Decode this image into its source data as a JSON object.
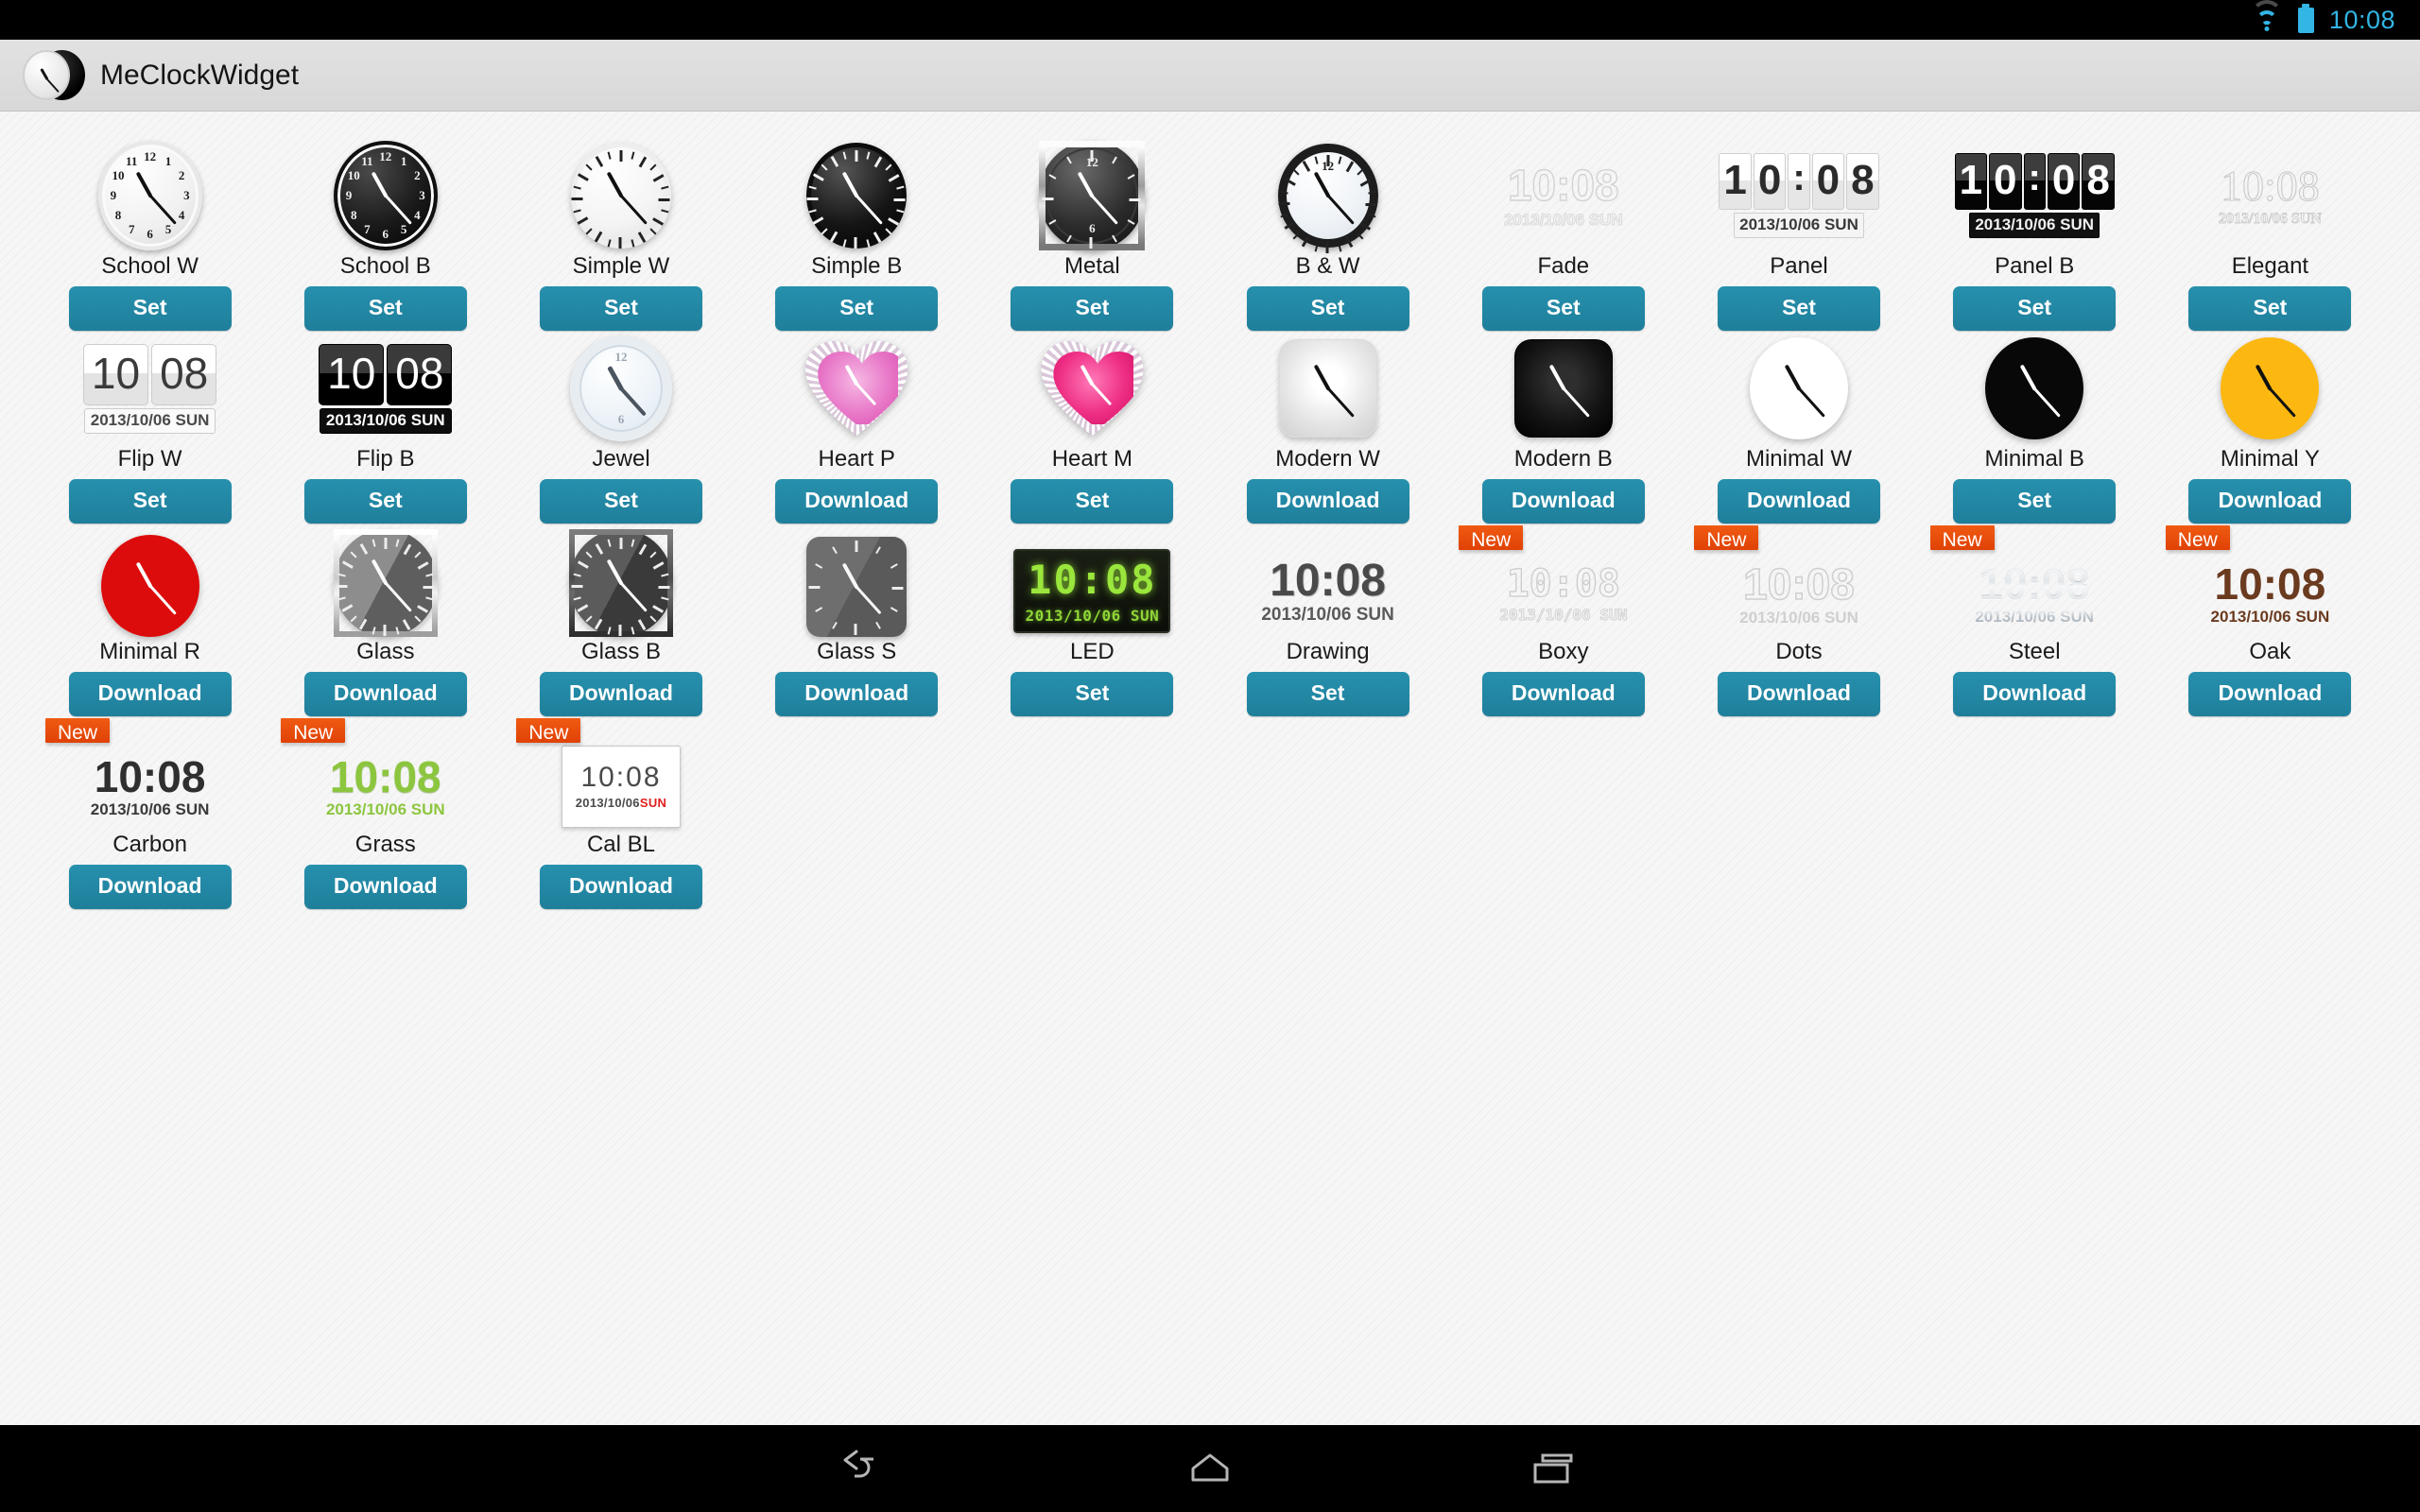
{
  "statusbar": {
    "time": "10:08",
    "wifi_icon": "wifi-icon",
    "battery_icon": "battery-icon",
    "accent_color": "#33b5e5"
  },
  "header": {
    "title": "MeClockWidget",
    "logo_icon": "clock-logo-icon"
  },
  "theme": {
    "button_color": "#1f7f9b",
    "badge_color": "#e8490a",
    "page_background": "#f6f6f6"
  },
  "labels": {
    "set": "Set",
    "download": "Download",
    "new": "New"
  },
  "widget_time": "10:08",
  "widget_date": "2013/10/06 SUN",
  "widget_hour": "10",
  "widget_minute": "08",
  "widgets": [
    {
      "name": "School W",
      "action": "Set",
      "new": false,
      "style": "school-white"
    },
    {
      "name": "School B",
      "action": "Set",
      "new": false,
      "style": "school-black"
    },
    {
      "name": "Simple W",
      "action": "Set",
      "new": false,
      "style": "simple-white"
    },
    {
      "name": "Simple B",
      "action": "Set",
      "new": false,
      "style": "simple-black"
    },
    {
      "name": "Metal",
      "action": "Set",
      "new": false,
      "style": "metal"
    },
    {
      "name": "B & W",
      "action": "Set",
      "new": false,
      "style": "bw"
    },
    {
      "name": "Fade",
      "action": "Set",
      "new": false,
      "style": "fade"
    },
    {
      "name": "Panel",
      "action": "Set",
      "new": false,
      "style": "panel-white"
    },
    {
      "name": "Panel B",
      "action": "Set",
      "new": false,
      "style": "panel-black"
    },
    {
      "name": "Elegant",
      "action": "Set",
      "new": false,
      "style": "elegant"
    },
    {
      "name": "Flip W",
      "action": "Set",
      "new": false,
      "style": "flip-white"
    },
    {
      "name": "Flip B",
      "action": "Set",
      "new": false,
      "style": "flip-black"
    },
    {
      "name": "Jewel",
      "action": "Set",
      "new": false,
      "style": "jewel"
    },
    {
      "name": "Heart P",
      "action": "Download",
      "new": false,
      "style": "heart-pink"
    },
    {
      "name": "Heart M",
      "action": "Set",
      "new": false,
      "style": "heart-magenta"
    },
    {
      "name": "Modern W",
      "action": "Download",
      "new": false,
      "style": "modern-white"
    },
    {
      "name": "Modern B",
      "action": "Download",
      "new": false,
      "style": "modern-black"
    },
    {
      "name": "Minimal W",
      "action": "Download",
      "new": false,
      "style": "minimal-white"
    },
    {
      "name": "Minimal B",
      "action": "Set",
      "new": false,
      "style": "minimal-black"
    },
    {
      "name": "Minimal Y",
      "action": "Download",
      "new": false,
      "style": "minimal-yellow"
    },
    {
      "name": "Minimal R",
      "action": "Download",
      "new": false,
      "style": "minimal-red"
    },
    {
      "name": "Glass",
      "action": "Download",
      "new": false,
      "style": "glass"
    },
    {
      "name": "Glass B",
      "action": "Download",
      "new": false,
      "style": "glass-b"
    },
    {
      "name": "Glass S",
      "action": "Download",
      "new": false,
      "style": "glass-s"
    },
    {
      "name": "LED",
      "action": "Set",
      "new": false,
      "style": "led"
    },
    {
      "name": "Drawing",
      "action": "Set",
      "new": false,
      "style": "drawing"
    },
    {
      "name": "Boxy",
      "action": "Download",
      "new": true,
      "style": "boxy"
    },
    {
      "name": "Dots",
      "action": "Download",
      "new": true,
      "style": "dots"
    },
    {
      "name": "Steel",
      "action": "Download",
      "new": true,
      "style": "steel"
    },
    {
      "name": "Oak",
      "action": "Download",
      "new": true,
      "style": "oak"
    },
    {
      "name": "Carbon",
      "action": "Download",
      "new": true,
      "style": "carbon"
    },
    {
      "name": "Grass",
      "action": "Download",
      "new": true,
      "style": "grass"
    },
    {
      "name": "Cal BL",
      "action": "Download",
      "new": true,
      "style": "cal-bl"
    }
  ],
  "navbar": {
    "back_icon": "back-arrow-icon",
    "home_icon": "home-icon",
    "recent_icon": "recent-apps-icon"
  }
}
